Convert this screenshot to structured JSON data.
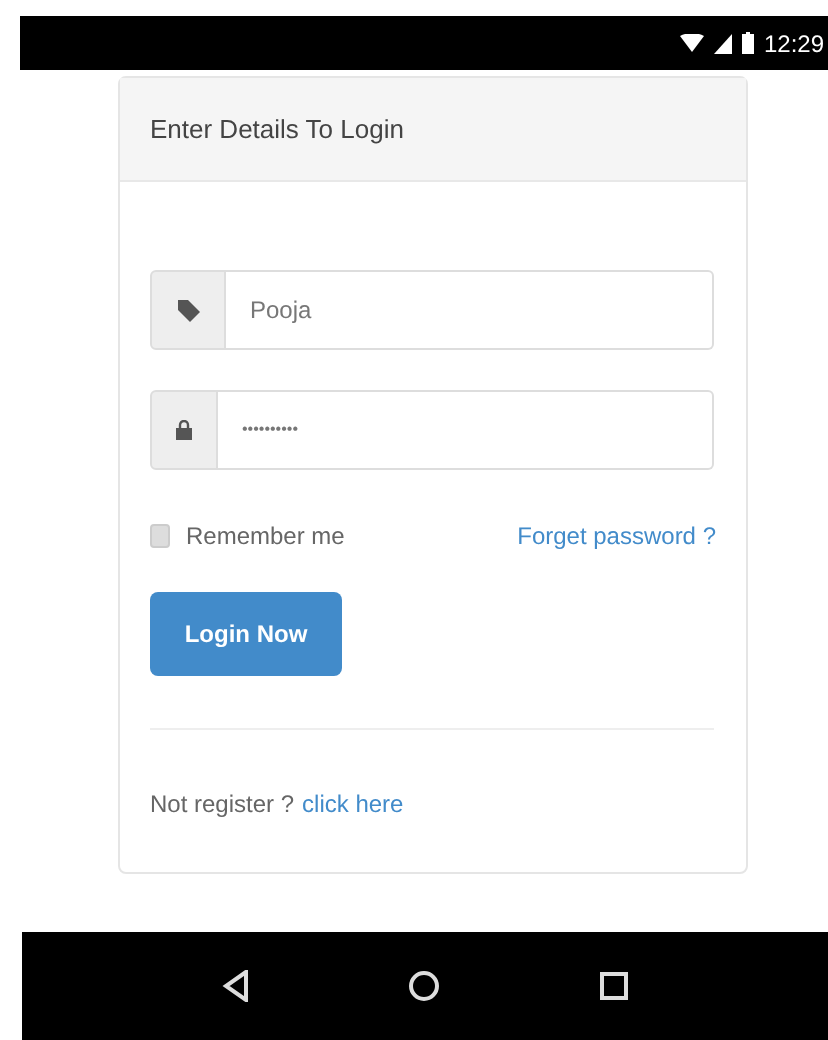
{
  "status_bar": {
    "time": "12:29"
  },
  "login_card": {
    "title": "Enter Details To Login",
    "username": {
      "value": "Pooja"
    },
    "password": {
      "value": "••••••••••"
    },
    "remember": {
      "label": "Remember me",
      "checked": false
    },
    "forgot_link": "Forget password ?",
    "login_button": "Login Now",
    "register_prompt": "Not register ?",
    "register_link": "click here"
  }
}
